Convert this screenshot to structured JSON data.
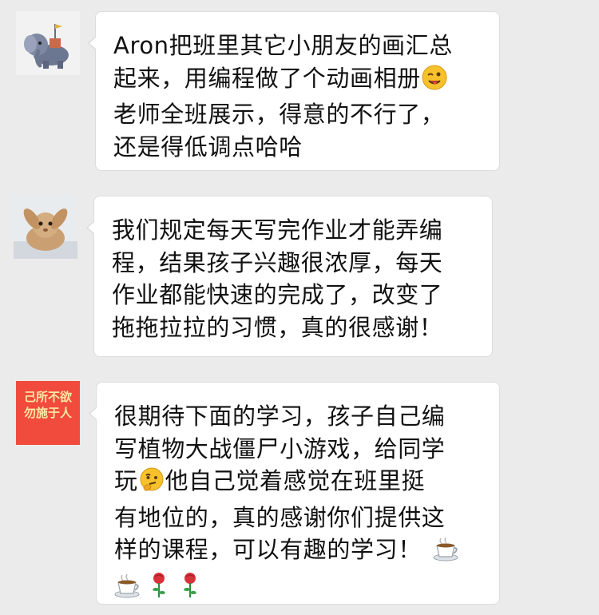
{
  "messages": [
    {
      "lines": [
        "Aron把班里其它小朋友的画汇总",
        "起来，用编程做了个动画相册",
        "老师全班展示，得意的不行了，",
        "还是得低调点哈哈"
      ]
    },
    {
      "lines": [
        "我们规定每天写完作业才能弄编",
        "程，结果孩子兴趣很浓厚，每天",
        "作业都能快速的完成了，改变了",
        "拖拖拉拉的习惯，真的很感谢！"
      ]
    },
    {
      "lines": [
        "很期待下面的学习，孩子自己编",
        "写植物大战僵尸小游戏，给同学",
        "玩",
        "他自己觉着感觉在班里挺",
        "有地位的，真的感谢你们提供这",
        "样的课程，可以有趣的学习！"
      ]
    }
  ],
  "avatars": {
    "third_text_line1": "己所不欲",
    "third_text_line2": "勿施于人"
  },
  "emoji_names": [
    "winking-face-emoji",
    "thinking-face-emoji",
    "hot-beverage-emoji",
    "rose-emoji"
  ],
  "colors": {
    "background": "#ebebeb",
    "bubble": "#ffffff",
    "text": "#111111",
    "avatar3_bg": "#f14b3d",
    "avatar3_text": "#ffe9a3"
  }
}
